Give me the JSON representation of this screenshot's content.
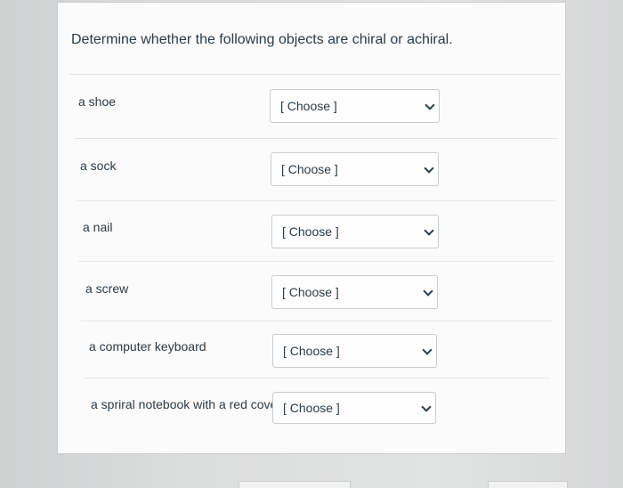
{
  "question": {
    "text": "Determine whether the following objects are  chiral or achiral."
  },
  "rows": [
    {
      "label": "a shoe",
      "select": {
        "value": "[ Choose ]"
      }
    },
    {
      "label": "a sock",
      "select": {
        "value": "[ Choose ]"
      }
    },
    {
      "label": "a nail",
      "select": {
        "value": "[ Choose ]"
      }
    },
    {
      "label": "a screw",
      "select": {
        "value": "[ Choose ]"
      }
    },
    {
      "label": "a computer keyboard",
      "select": {
        "value": "[ Choose ]"
      }
    },
    {
      "label": "a spriral notebook with a red cover",
      "select": {
        "value": "[ Choose ]"
      }
    }
  ],
  "icons": {
    "dropdown": "chevron-down-icon"
  },
  "colors": {
    "text": "#2d3b45",
    "border": "#c7cdd1",
    "card": "#fbfbfb"
  }
}
